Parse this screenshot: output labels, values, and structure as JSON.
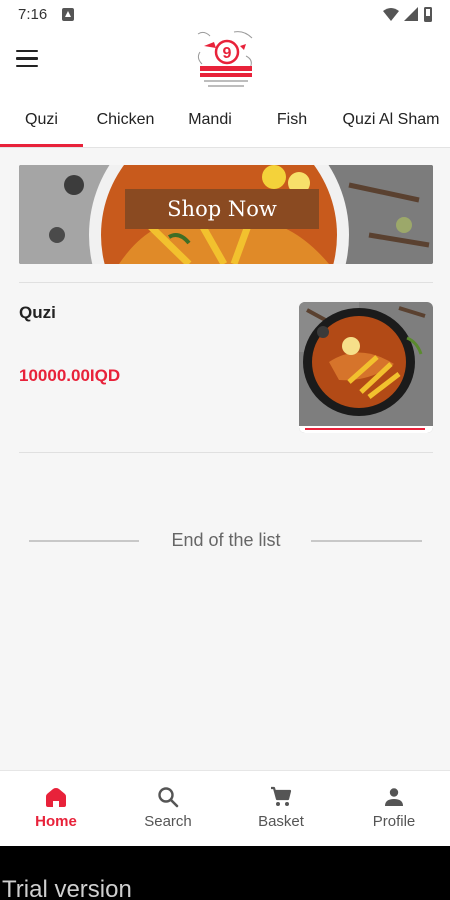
{
  "status_bar": {
    "time": "7:16"
  },
  "header": {
    "menu_icon": "hamburger-menu-icon",
    "logo_text": "9"
  },
  "tabs": [
    {
      "label": "Quzi",
      "active": true
    },
    {
      "label": "Chicken",
      "active": false
    },
    {
      "label": "Mandi",
      "active": false
    },
    {
      "label": "Fish",
      "active": false
    },
    {
      "label": "Quzi Al Sham",
      "active": false
    }
  ],
  "banner": {
    "button_label": "Shop Now"
  },
  "products": [
    {
      "name": "Quzi",
      "price": "10000.00IQD"
    }
  ],
  "list_end_text": "End of the list",
  "bottom_nav": [
    {
      "label": "Home",
      "icon": "home-icon",
      "active": true
    },
    {
      "label": "Search",
      "icon": "search-icon",
      "active": false
    },
    {
      "label": "Basket",
      "icon": "cart-icon",
      "active": false
    },
    {
      "label": "Profile",
      "icon": "profile-icon",
      "active": false
    }
  ],
  "trial_text": "Trial version",
  "colors": {
    "accent": "#e8223a",
    "banner_button": "#8a4a21"
  }
}
